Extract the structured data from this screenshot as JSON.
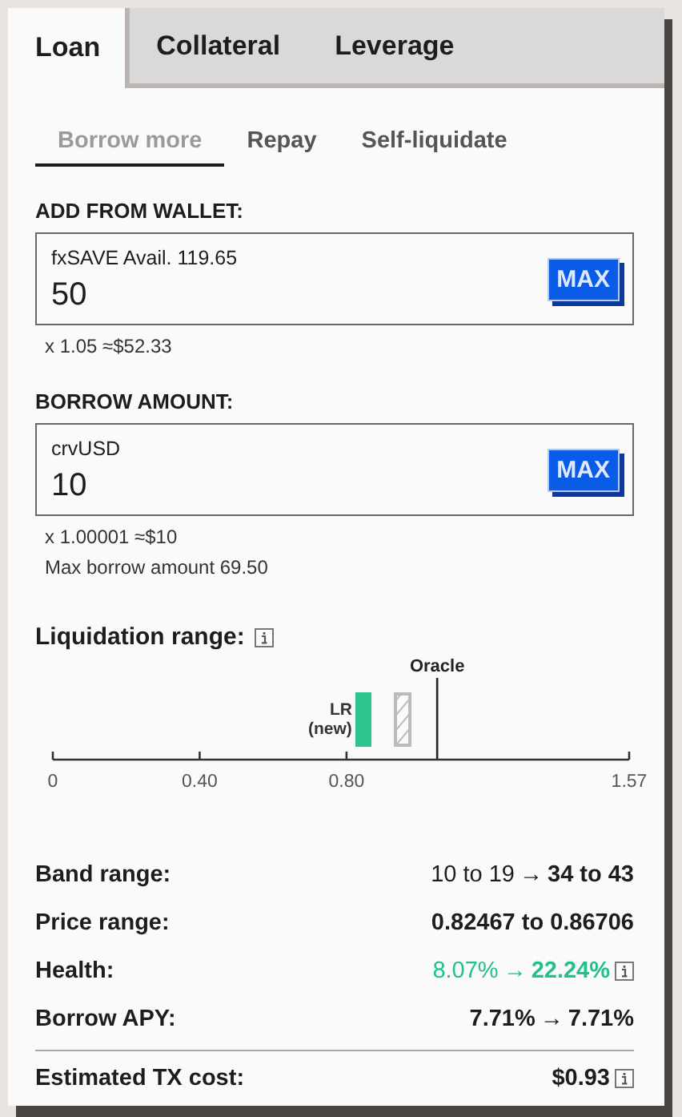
{
  "tabs": [
    {
      "label": "Loan",
      "selected": true
    },
    {
      "label": "Collateral",
      "selected": false
    },
    {
      "label": "Leverage",
      "selected": false
    }
  ],
  "subtabs": [
    {
      "label": "Borrow more",
      "selected": true
    },
    {
      "label": "Repay",
      "selected": false
    },
    {
      "label": "Self-liquidate",
      "selected": false
    }
  ],
  "fields": [
    {
      "heading": "ADD FROM WALLET:",
      "token_label": "fxSAVE Avail. 119.65",
      "value": "50",
      "button": "MAX",
      "notes": [
        "x 1.05 ≈$52.33"
      ]
    },
    {
      "heading": "BORROW AMOUNT:",
      "token_label": "crvUSD",
      "value": "10",
      "button": "MAX",
      "notes": [
        "x 1.00001 ≈$10",
        "Max borrow amount 69.50"
      ]
    }
  ],
  "liquidation_range": {
    "title": "Liquidation range:",
    "info": true,
    "ticks": [
      "0",
      "0.40",
      "0.80",
      "1.57"
    ],
    "new_range_label": "LR (new)",
    "oracle_label": "Oracle"
  },
  "details": [
    {
      "label": "Band range:",
      "kind": "change",
      "from": "10 to 19",
      "arrow": "→",
      "to": "34 to 43"
    },
    {
      "label": "Price range:",
      "kind": "value",
      "value": "0.82467 to 0.86706"
    },
    {
      "label": "Health:",
      "kind": "change",
      "from": "8.07%",
      "arrow": "→",
      "to": "22.24%",
      "color": "#22c08a",
      "info": true
    },
    {
      "label": "Borrow APY:",
      "kind": "change-strong",
      "from": "7.71%",
      "arrow": "→",
      "to": "7.71%"
    }
  ],
  "footer": {
    "label": "Estimated TX cost:",
    "value": "$0.93",
    "info": true
  }
}
